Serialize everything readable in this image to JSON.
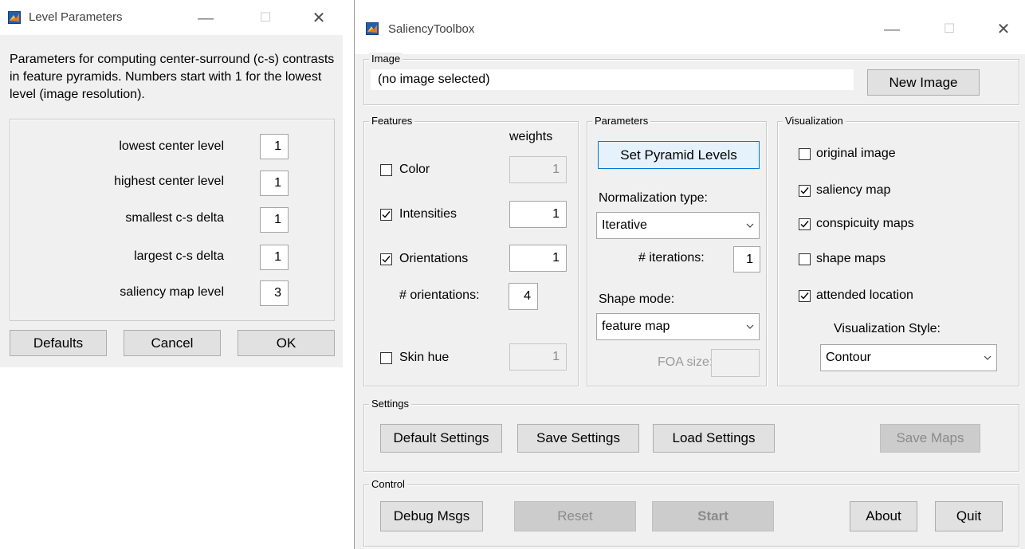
{
  "level_dialog": {
    "title": "Level Parameters",
    "description": "Parameters for computing center-surround (c-s) contrasts in feature pyramids. Numbers start with 1 for the lowest level (image resolution).",
    "fields": [
      {
        "label": "lowest center level",
        "value": "1"
      },
      {
        "label": "highest center level",
        "value": "1"
      },
      {
        "label": "smallest c-s delta",
        "value": "1"
      },
      {
        "label": "largest c-s delta",
        "value": "1"
      },
      {
        "label": "saliency map level",
        "value": "3"
      }
    ],
    "buttons": {
      "defaults": "Defaults",
      "cancel": "Cancel",
      "ok": "OK"
    }
  },
  "toolbox": {
    "title": "SaliencyToolbox",
    "image_panel": {
      "title": "Image",
      "filename": "(no image selected)",
      "new_image": "New Image"
    },
    "features_panel": {
      "title": "Features",
      "weights_header": "weights",
      "items": [
        {
          "label": "Color",
          "checked": false,
          "weight": "1",
          "enabled": false
        },
        {
          "label": "Intensities",
          "checked": true,
          "weight": "1",
          "enabled": true
        },
        {
          "label": "Orientations",
          "checked": true,
          "weight": "1",
          "enabled": true
        },
        {
          "label": "Skin hue",
          "checked": false,
          "weight": "1",
          "enabled": false
        }
      ],
      "num_orientations_label": "# orientations:",
      "num_orientations": "4"
    },
    "parameters_panel": {
      "title": "Parameters",
      "set_pyramid_levels": "Set Pyramid Levels",
      "normalization_label": "Normalization type:",
      "normalization_value": "Iterative",
      "iterations_label": "# iterations:",
      "iterations_value": "1",
      "shape_mode_label": "Shape mode:",
      "shape_mode_value": "feature map",
      "foa_size_label": "FOA size:",
      "foa_size_value": ""
    },
    "visualization_panel": {
      "title": "Visualization",
      "items": [
        {
          "label": "original image",
          "checked": false
        },
        {
          "label": "saliency map",
          "checked": true
        },
        {
          "label": "conspicuity maps",
          "checked": true
        },
        {
          "label": "shape maps",
          "checked": false
        },
        {
          "label": "attended location",
          "checked": true
        }
      ],
      "style_label": "Visualization Style:",
      "style_value": "Contour"
    },
    "settings_panel": {
      "title": "Settings",
      "default_settings": "Default Settings",
      "save_settings": "Save Settings",
      "load_settings": "Load Settings",
      "save_maps": "Save Maps"
    },
    "control_panel": {
      "title": "Control",
      "debug_msgs": "Debug Msgs",
      "reset": "Reset",
      "start": "Start",
      "about": "About",
      "quit": "Quit"
    }
  }
}
